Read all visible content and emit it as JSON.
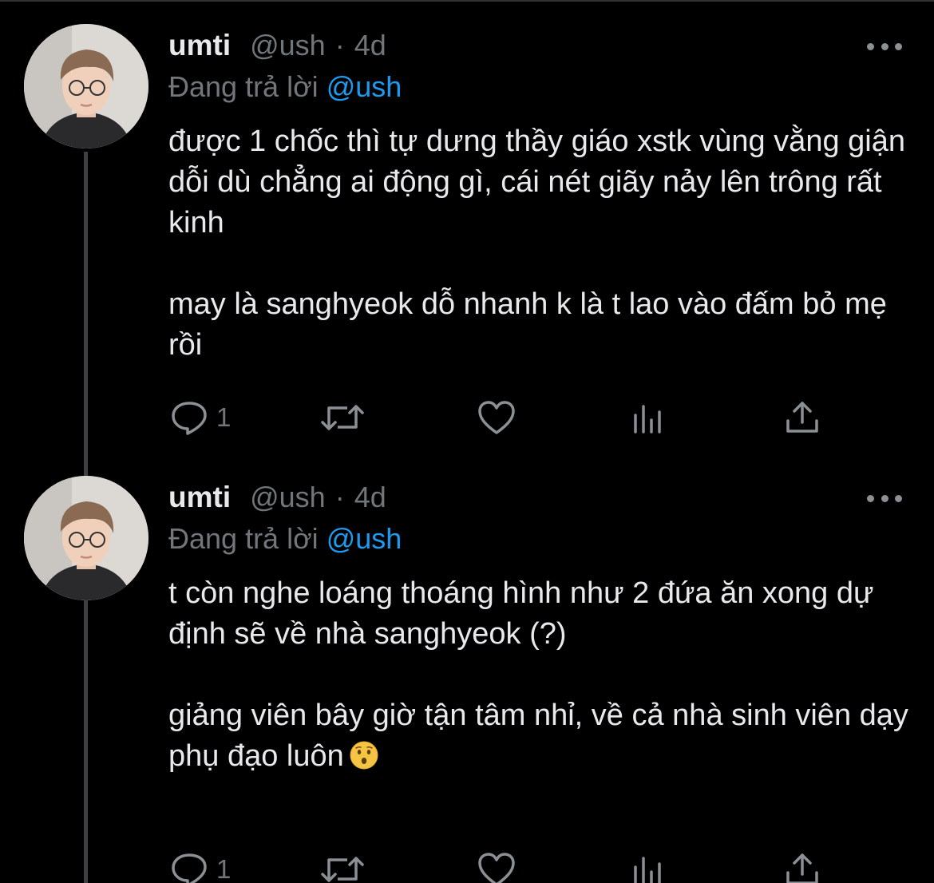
{
  "colors": {
    "background": "#000000",
    "primary_text": "#e7e9ea",
    "secondary_text": "#71767b",
    "accent": "#1d9bf0",
    "thread_line": "#3e4144"
  },
  "tweets": [
    {
      "name": "umti",
      "handle": "@ush",
      "separator": "·",
      "time": "4d",
      "reply_prefix": "Đang trả lời",
      "reply_mention": "@ush",
      "paragraphs": [
        "được 1 chốc thì tự dưng thầy giáo xstk vùng vằng giận dỗi dù chẳng ai động gì, cái nét giãy nảy lên trông rất kinh",
        "may là sanghyeok dỗ nhanh k là t lao vào đấm bỏ mẹ rồi"
      ],
      "reply_count": "1",
      "icons": [
        "reply-icon",
        "retweet-icon",
        "like-icon",
        "stats-icon",
        "share-icon",
        "more-icon"
      ]
    },
    {
      "name": "umti",
      "handle": "@ush",
      "separator": "·",
      "time": "4d",
      "reply_prefix": "Đang trả lời",
      "reply_mention": "@ush",
      "paragraphs": [
        "t còn nghe loáng thoáng hình như 2 đứa ăn xong dự định sẽ về nhà sanghyeok (?)",
        "giảng viên bây giờ tận tâm nhỉ, về cả nhà sinh viên dạy phụ đạo luôn"
      ],
      "trailing_emoji": "hushed-face-emoji",
      "reply_count": "1",
      "icons": [
        "reply-icon",
        "retweet-icon",
        "like-icon",
        "stats-icon",
        "share-icon",
        "more-icon"
      ]
    }
  ]
}
